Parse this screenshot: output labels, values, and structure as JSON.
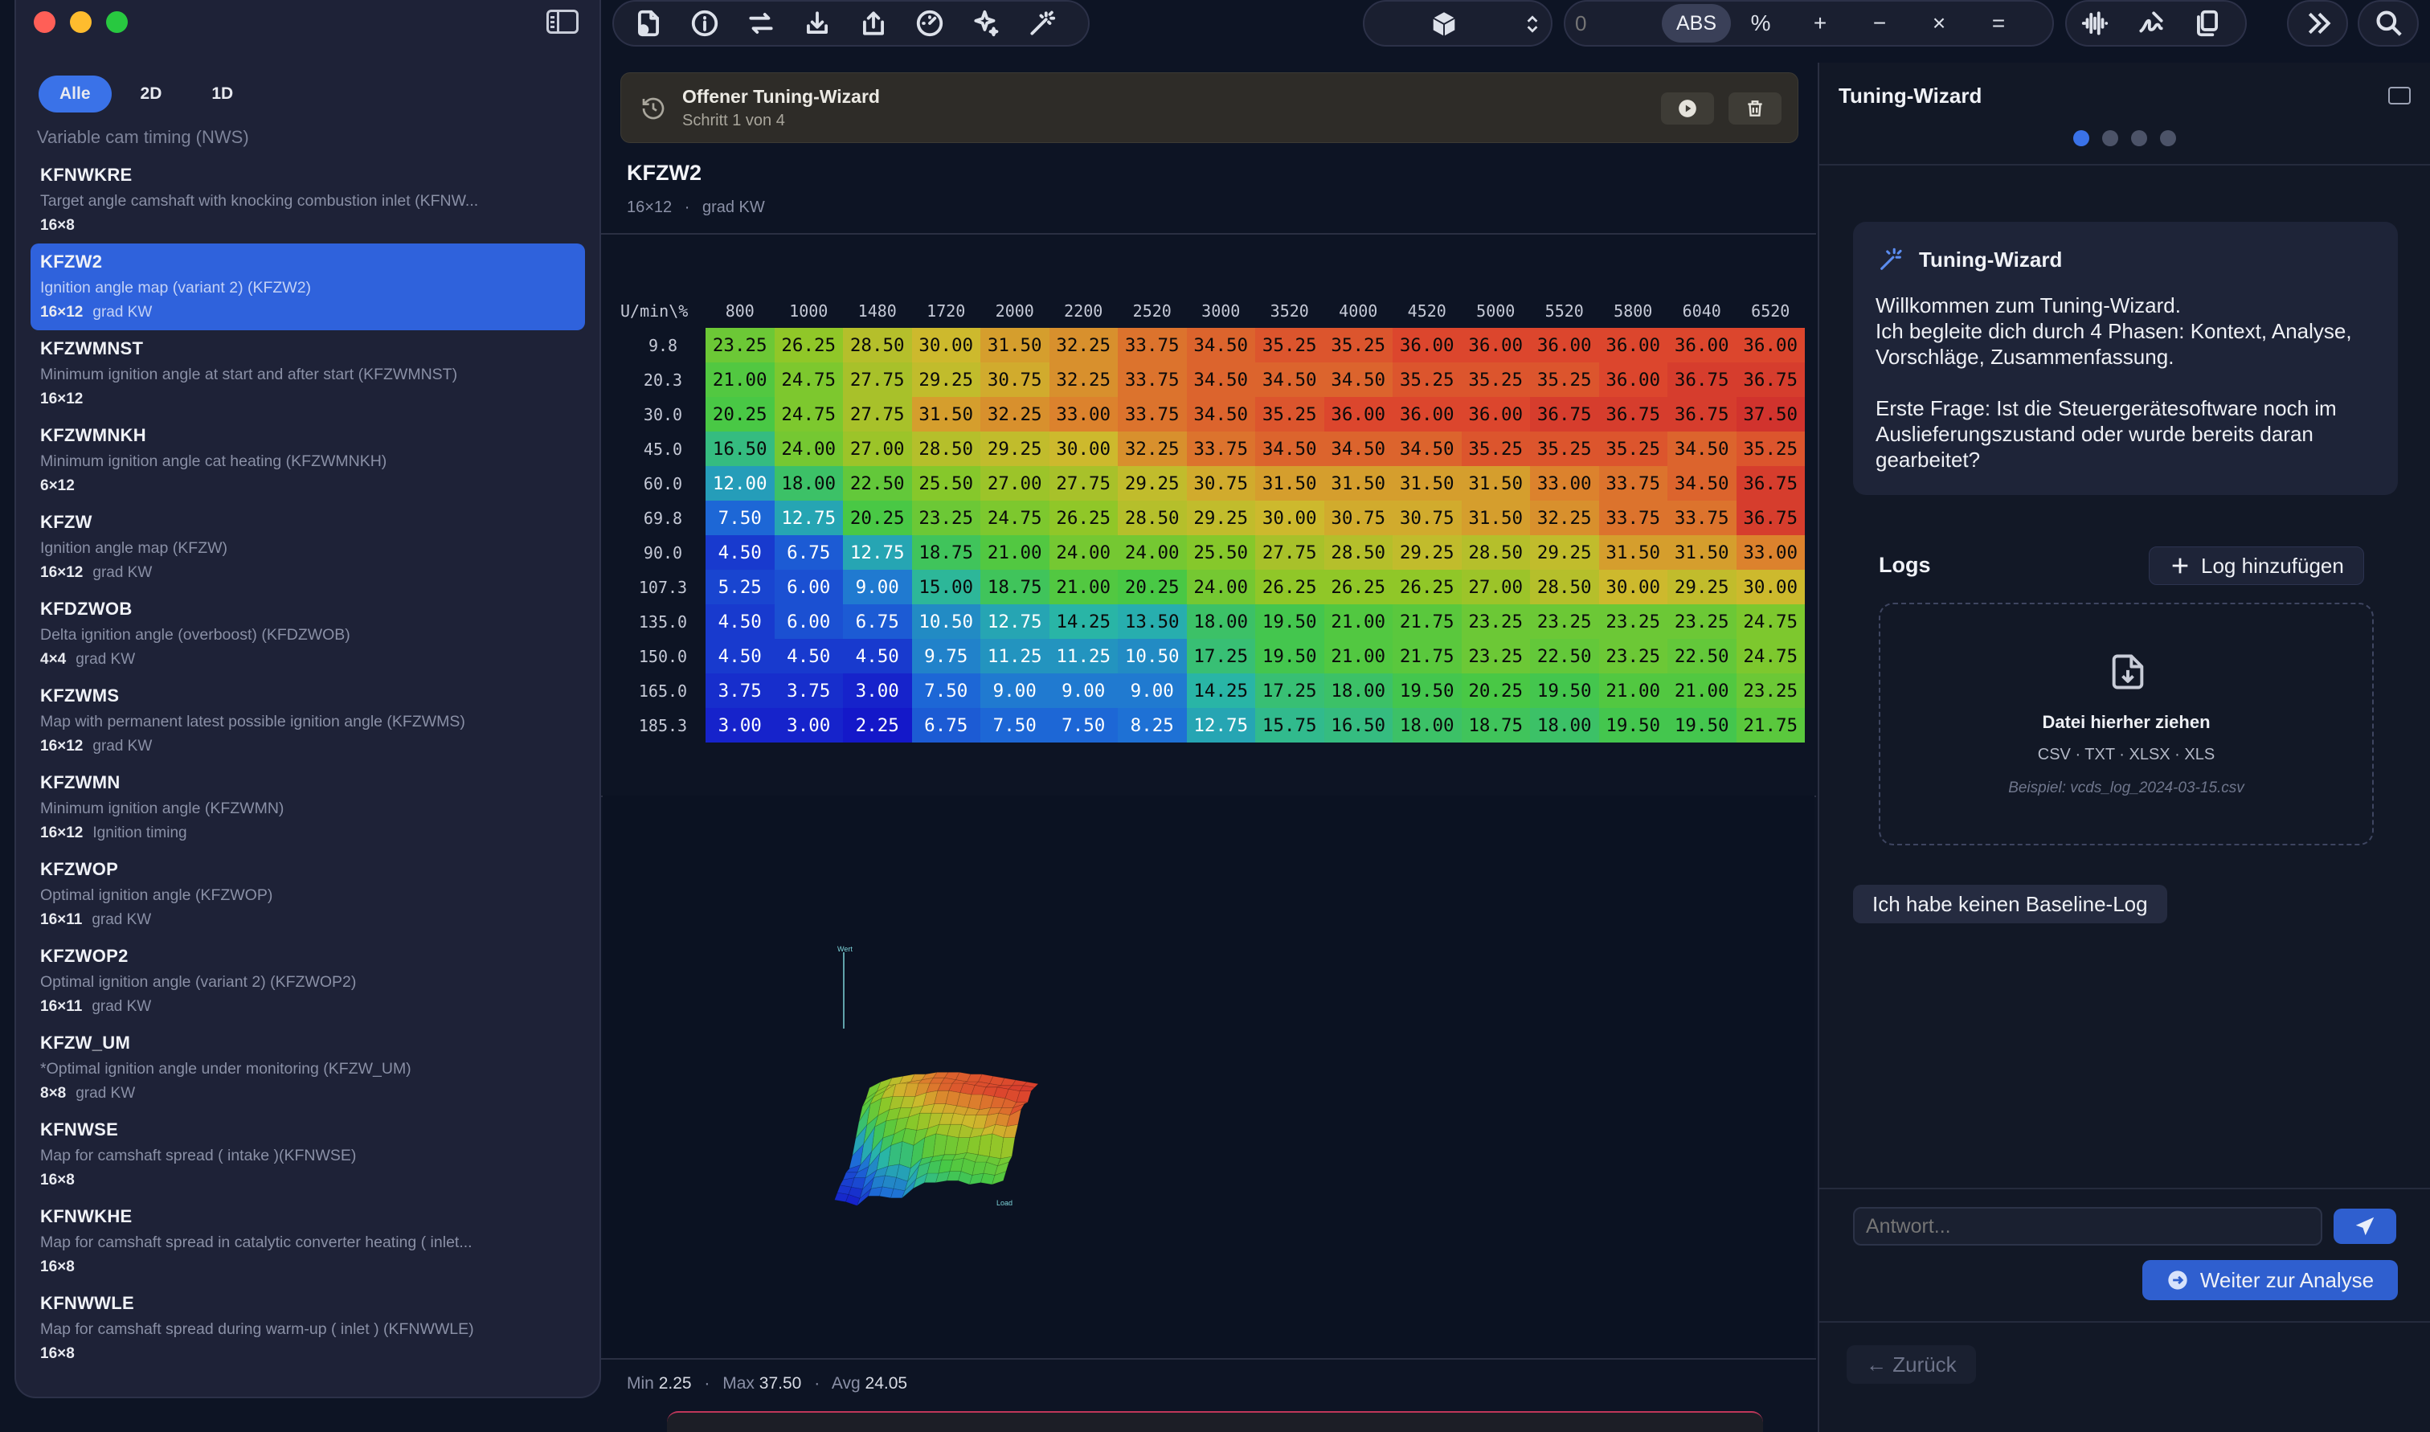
{
  "colors": {
    "accent": "#3a72e8",
    "close": "#ff5f57",
    "minimize": "#febc2e",
    "zoom": "#28c840"
  },
  "sidebar": {
    "filters": [
      {
        "label": "Alle",
        "active": true
      },
      {
        "label": "2D",
        "active": false
      },
      {
        "label": "1D",
        "active": false
      }
    ],
    "section": "Variable cam timing (NWS)",
    "items": [
      {
        "name": "KFNWKRE",
        "desc": "Target angle camshaft with knocking combustion inlet (KFNW...",
        "size": "16×8",
        "unit": ""
      },
      {
        "name": "KFZW2",
        "desc": "Ignition angle map (variant 2) (KFZW2)",
        "size": "16×12",
        "unit": "grad KW",
        "active": true
      },
      {
        "name": "KFZWMNST",
        "desc": "Minimum ignition angle at start and after start (KFZWMNST)",
        "size": "16×12",
        "unit": ""
      },
      {
        "name": "KFZWMNKH",
        "desc": "Minimum ignition angle cat heating (KFZWMNKH)",
        "size": "6×12",
        "unit": ""
      },
      {
        "name": "KFZW",
        "desc": "Ignition angle map (KFZW)",
        "size": "16×12",
        "unit": "grad KW"
      },
      {
        "name": "KFDZWOB",
        "desc": "Delta ignition angle (overboost) (KFDZWOB)",
        "size": "4×4",
        "unit": "grad KW"
      },
      {
        "name": "KFZWMS",
        "desc": "Map with permanent latest possible ignition angle (KFZWMS)",
        "size": "16×12",
        "unit": "grad KW"
      },
      {
        "name": "KFZWMN",
        "desc": "Minimum ignition angle (KFZWMN)",
        "size": "16×12",
        "unit": "Ignition timing"
      },
      {
        "name": "KFZWOP",
        "desc": "Optimal ignition angle (KFZWOP)",
        "size": "16×11",
        "unit": "grad KW"
      },
      {
        "name": "KFZWOP2",
        "desc": "Optimal ignition angle (variant 2) (KFZWOP2)",
        "size": "16×11",
        "unit": "grad KW"
      },
      {
        "name": "KFZW_UM",
        "desc": "*Optimal ignition angle under monitoring (KFZW_UM)",
        "size": "8×8",
        "unit": "grad KW"
      },
      {
        "name": "KFNWSE",
        "desc": "Map for camshaft spread ( intake )(KFNWSE)",
        "size": "16×8",
        "unit": ""
      },
      {
        "name": "KFNWKHE",
        "desc": "Map for camshaft spread in catalytic converter heating ( inlet...",
        "size": "16×8",
        "unit": ""
      },
      {
        "name": "KFNWWLE",
        "desc": "Map for camshaft spread during warm-up ( inlet ) (KFNWWLE)",
        "size": "16×8",
        "unit": ""
      }
    ]
  },
  "toolbar": {
    "icons": [
      "new-file-icon",
      "info-icon",
      "swap-icon",
      "import-icon",
      "export-icon",
      "gauge-icon",
      "sparkle-icon",
      "magic-wand-icon"
    ],
    "input_placeholder": "0",
    "abs_label": "ABS",
    "ops": [
      "%",
      "+",
      "−",
      "×",
      "="
    ]
  },
  "banner": {
    "title": "Offener Tuning-Wizard",
    "subtitle": "Schritt 1 von 4"
  },
  "map": {
    "name": "KFZW2",
    "size": "16×12",
    "sep": "·",
    "unit": "grad KW",
    "corner": "U/min\\%",
    "cols": [
      "800",
      "1000",
      "1480",
      "1720",
      "2000",
      "2200",
      "2520",
      "3000",
      "3520",
      "4000",
      "4520",
      "5000",
      "5520",
      "5800",
      "6040",
      "6520"
    ],
    "rows": [
      {
        "h": "9.8",
        "v": [
          "23.25",
          "26.25",
          "28.50",
          "30.00",
          "31.50",
          "32.25",
          "33.75",
          "34.50",
          "35.25",
          "35.25",
          "36.00",
          "36.00",
          "36.00",
          "36.00",
          "36.00",
          "36.00"
        ]
      },
      {
        "h": "20.3",
        "v": [
          "21.00",
          "24.75",
          "27.75",
          "29.25",
          "30.75",
          "32.25",
          "33.75",
          "34.50",
          "34.50",
          "34.50",
          "35.25",
          "35.25",
          "35.25",
          "36.00",
          "36.75",
          "36.75"
        ]
      },
      {
        "h": "30.0",
        "v": [
          "20.25",
          "24.75",
          "27.75",
          "31.50",
          "32.25",
          "33.00",
          "33.75",
          "34.50",
          "35.25",
          "36.00",
          "36.00",
          "36.00",
          "36.75",
          "36.75",
          "36.75",
          "37.50"
        ]
      },
      {
        "h": "45.0",
        "v": [
          "16.50",
          "24.00",
          "27.00",
          "28.50",
          "29.25",
          "30.00",
          "32.25",
          "33.75",
          "34.50",
          "34.50",
          "34.50",
          "35.25",
          "35.25",
          "35.25",
          "34.50",
          "35.25"
        ]
      },
      {
        "h": "60.0",
        "v": [
          "12.00",
          "18.00",
          "22.50",
          "25.50",
          "27.00",
          "27.75",
          "29.25",
          "30.75",
          "31.50",
          "31.50",
          "31.50",
          "31.50",
          "33.00",
          "33.75",
          "34.50",
          "36.75"
        ]
      },
      {
        "h": "69.8",
        "v": [
          "7.50",
          "12.75",
          "20.25",
          "23.25",
          "24.75",
          "26.25",
          "28.50",
          "29.25",
          "30.00",
          "30.75",
          "30.75",
          "31.50",
          "32.25",
          "33.75",
          "33.75",
          "36.75"
        ]
      },
      {
        "h": "90.0",
        "v": [
          "4.50",
          "6.75",
          "12.75",
          "18.75",
          "21.00",
          "24.00",
          "24.00",
          "25.50",
          "27.75",
          "28.50",
          "29.25",
          "28.50",
          "29.25",
          "31.50",
          "31.50",
          "33.00"
        ]
      },
      {
        "h": "107.3",
        "v": [
          "5.25",
          "6.00",
          "9.00",
          "15.00",
          "18.75",
          "21.00",
          "20.25",
          "24.00",
          "26.25",
          "26.25",
          "26.25",
          "27.00",
          "28.50",
          "30.00",
          "29.25",
          "30.00"
        ]
      },
      {
        "h": "135.0",
        "v": [
          "4.50",
          "6.00",
          "6.75",
          "10.50",
          "12.75",
          "14.25",
          "13.50",
          "18.00",
          "19.50",
          "21.00",
          "21.75",
          "23.25",
          "23.25",
          "23.25",
          "23.25",
          "24.75"
        ]
      },
      {
        "h": "150.0",
        "v": [
          "4.50",
          "4.50",
          "4.50",
          "9.75",
          "11.25",
          "11.25",
          "10.50",
          "17.25",
          "19.50",
          "21.00",
          "21.75",
          "23.25",
          "22.50",
          "23.25",
          "22.50",
          "24.75"
        ]
      },
      {
        "h": "165.0",
        "v": [
          "3.75",
          "3.75",
          "3.00",
          "7.50",
          "9.00",
          "9.00",
          "9.00",
          "14.25",
          "17.25",
          "18.00",
          "19.50",
          "20.25",
          "19.50",
          "21.00",
          "21.00",
          "23.25"
        ]
      },
      {
        "h": "185.3",
        "v": [
          "3.00",
          "3.00",
          "2.25",
          "6.75",
          "7.50",
          "7.50",
          "8.25",
          "12.75",
          "15.75",
          "16.50",
          "18.00",
          "18.75",
          "18.00",
          "19.50",
          "19.50",
          "21.75"
        ]
      }
    ],
    "plot_labels": {
      "z": "Wert",
      "x": "Load"
    },
    "stats": {
      "min_label": "Min",
      "min": "2.25",
      "max_label": "Max",
      "max": "37.50",
      "avg_label": "Avg",
      "avg": "24.05",
      "sep": "·"
    }
  },
  "wizard": {
    "title": "Tuning-Wizard",
    "step_total": 4,
    "step_current": 1,
    "card_title": "Tuning-Wizard",
    "message_1": "Willkommen zum Tuning-Wizard.",
    "message_2": "Ich begleite dich durch 4 Phasen: Kontext, Analyse, Vorschläge, Zusammenfassung.",
    "message_3": "Erste Frage: Ist die Steuergerätesoftware noch im Auslieferungszustand oder wurde bereits daran gearbeitet?",
    "logs_label": "Logs",
    "add_log": "Log hinzufügen",
    "drop_title": "Datei hierher ziehen",
    "drop_formats": "CSV · TXT · XLSX · XLS",
    "drop_example": "Beispiel: vcds_log_2024-03-15.csv",
    "no_baseline": "Ich habe keinen Baseline-Log",
    "answer_placeholder": "Antwort...",
    "next_label": "Weiter zur Analyse",
    "back_label": "← Zurück"
  }
}
